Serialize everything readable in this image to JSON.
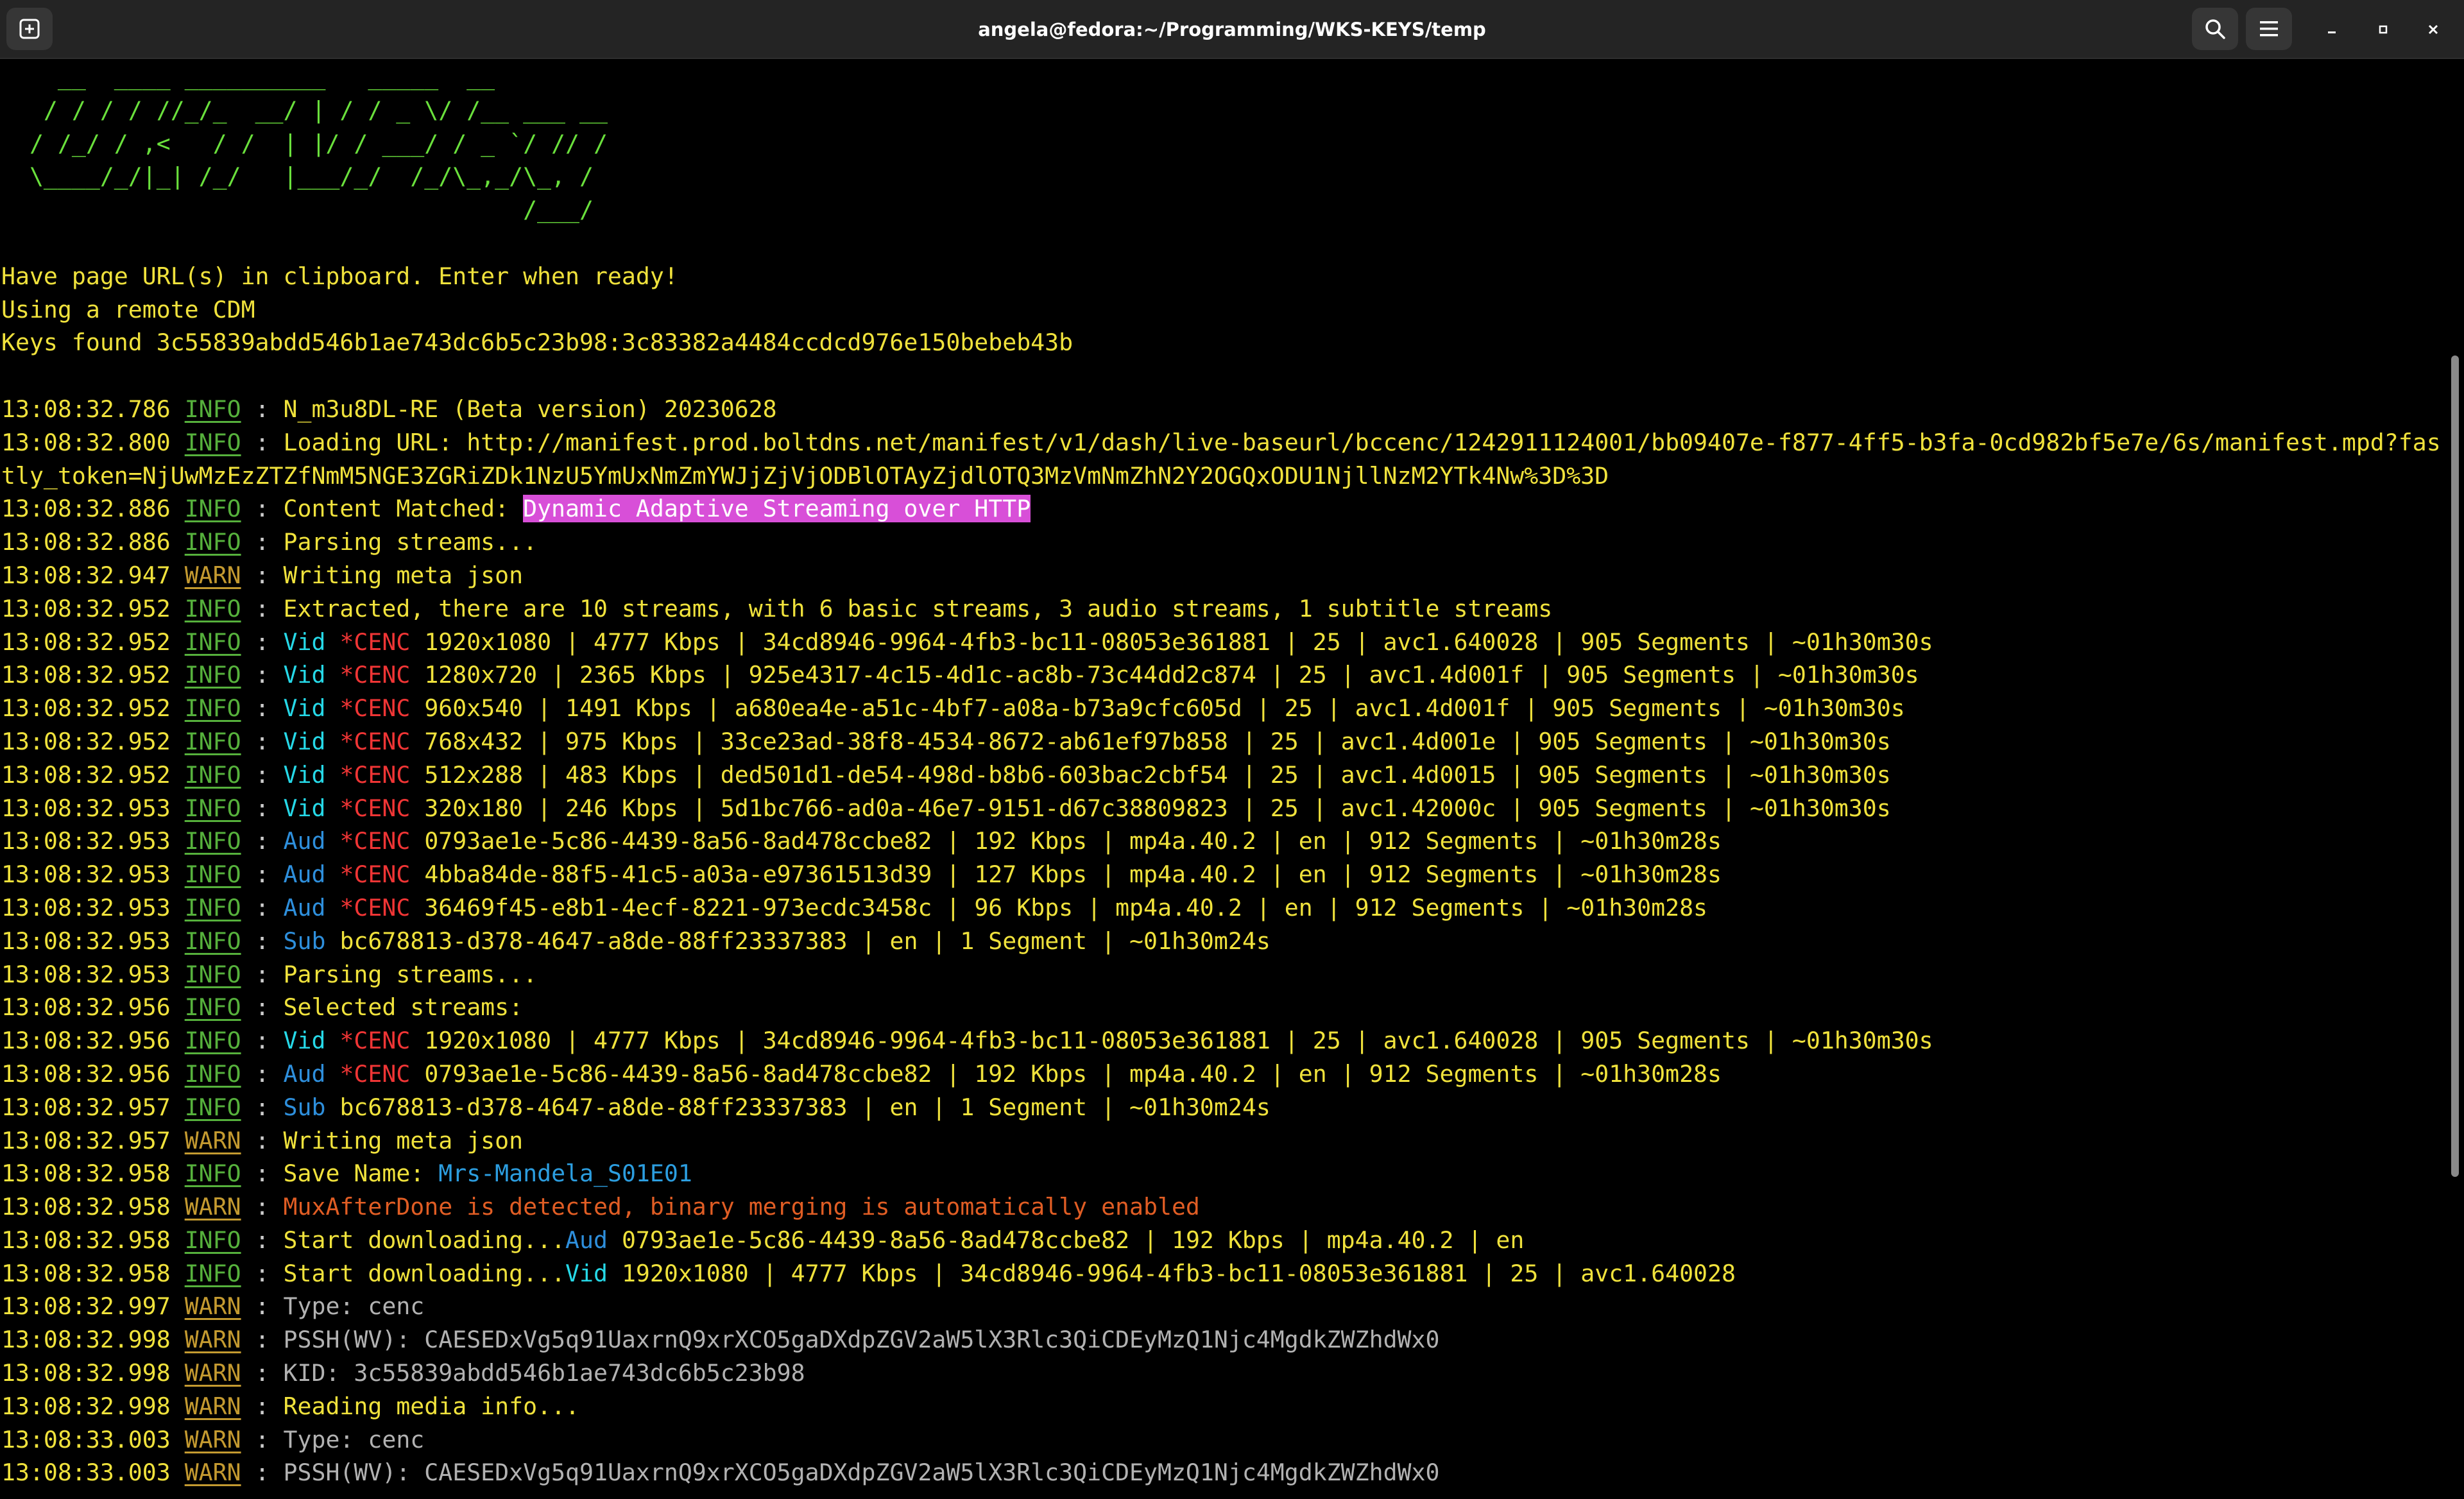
{
  "window": {
    "title": "angela@fedora:~/Programming/WKS-KEYS/temp",
    "icons": {
      "new_tab": "new-tab-icon",
      "search": "search-icon",
      "menu": "hamburger-menu-icon",
      "minimize": "minimize-icon",
      "maximize": "maximize-icon",
      "close": "close-icon"
    }
  },
  "terminal": {
    "banner": [
      "    __  ____ __________   _____  __",
      "   / / / / //_/_  __/ | / / _ \\/ /__ ___ __",
      "  / /_/ / ,<   / /  | |/ / ___/ / _ `/ // /",
      "  \\____/_/|_| /_/   |___/_/  /_/\\_,_/\\_, /",
      "                                     /___/"
    ],
    "messages": [
      "Have page URL(s) in clipboard. Enter when ready!",
      "Using a remote CDM",
      "Keys found 3c55839abdd546b1ae743dc6b5c23b98:3c83382a4484ccdcd976e150bebeb43b"
    ],
    "log": [
      {
        "time": "13:08:32.786",
        "level": "INFO",
        "text": "N_m3u8DL-RE (Beta version) 20230628"
      },
      {
        "time": "13:08:32.800",
        "level": "INFO",
        "text": "Loading URL: http://manifest.prod.boltdns.net/manifest/v1/dash/live-baseurl/bccenc/1242911124001/bb09407e-f877-4ff5-b3fa-0cd982bf5e7e/6s/manifest.mpd?fas",
        "cont": "tly_token=NjUwMzEzZTZfNmM5NGE3ZGRiZDk1NzU5YmUxNmZmYWJjZjVjODBlOTAyZjdlOTQ3MzVmNmZhN2Y2OGQxODU1NjllNzM2YTk4Nw%3D%3D"
      },
      {
        "time": "13:08:32.886",
        "level": "INFO",
        "pre": "Content Matched: ",
        "highlight": "Dynamic Adaptive Streaming over HTTP"
      },
      {
        "time": "13:08:32.886",
        "level": "INFO",
        "text": "Parsing streams..."
      },
      {
        "time": "13:08:32.947",
        "level": "WARN",
        "text": "Writing meta json"
      },
      {
        "time": "13:08:32.952",
        "level": "INFO",
        "text": "Extracted, there are 10 streams, with 6 basic streams, 3 audio streams, 1 subtitle streams"
      },
      {
        "time": "13:08:32.952",
        "level": "INFO",
        "kind": "Vid",
        "cenc": "*CENC",
        "text": "1920x1080 | 4777 Kbps | 34cd8946-9964-4fb3-bc11-08053e361881 | 25 | avc1.640028 | 905 Segments | ~01h30m30s"
      },
      {
        "time": "13:08:32.952",
        "level": "INFO",
        "kind": "Vid",
        "cenc": "*CENC",
        "text": "1280x720 | 2365 Kbps | 925e4317-4c15-4d1c-ac8b-73c44dd2c874 | 25 | avc1.4d001f | 905 Segments | ~01h30m30s"
      },
      {
        "time": "13:08:32.952",
        "level": "INFO",
        "kind": "Vid",
        "cenc": "*CENC",
        "text": "960x540 | 1491 Kbps | a680ea4e-a51c-4bf7-a08a-b73a9cfc605d | 25 | avc1.4d001f | 905 Segments | ~01h30m30s"
      },
      {
        "time": "13:08:32.952",
        "level": "INFO",
        "kind": "Vid",
        "cenc": "*CENC",
        "text": "768x432 | 975 Kbps | 33ce23ad-38f8-4534-8672-ab61ef97b858 | 25 | avc1.4d001e | 905 Segments | ~01h30m30s"
      },
      {
        "time": "13:08:32.952",
        "level": "INFO",
        "kind": "Vid",
        "cenc": "*CENC",
        "text": "512x288 | 483 Kbps | ded501d1-de54-498d-b8b6-603bac2cbf54 | 25 | avc1.4d0015 | 905 Segments | ~01h30m30s"
      },
      {
        "time": "13:08:32.953",
        "level": "INFO",
        "kind": "Vid",
        "cenc": "*CENC",
        "text": "320x180 | 246 Kbps | 5d1bc766-ad0a-46e7-9151-d67c38809823 | 25 | avc1.42000c | 905 Segments | ~01h30m30s"
      },
      {
        "time": "13:08:32.953",
        "level": "INFO",
        "kind": "Aud",
        "cenc": "*CENC",
        "text": "0793ae1e-5c86-4439-8a56-8ad478ccbe82 | 192 Kbps | mp4a.40.2 | en | 912 Segments | ~01h30m28s"
      },
      {
        "time": "13:08:32.953",
        "level": "INFO",
        "kind": "Aud",
        "cenc": "*CENC",
        "text": "4bba84de-88f5-41c5-a03a-e97361513d39 | 127 Kbps | mp4a.40.2 | en | 912 Segments | ~01h30m28s"
      },
      {
        "time": "13:08:32.953",
        "level": "INFO",
        "kind": "Aud",
        "cenc": "*CENC",
        "text": "36469f45-e8b1-4ecf-8221-973ecdc3458c | 96 Kbps | mp4a.40.2 | en | 912 Segments | ~01h30m28s"
      },
      {
        "time": "13:08:32.953",
        "level": "INFO",
        "kind": "Sub",
        "text": "bc678813-d378-4647-a8de-88ff23337383 | en | 1 Segment | ~01h30m24s"
      },
      {
        "time": "13:08:32.953",
        "level": "INFO",
        "text": "Parsing streams..."
      },
      {
        "time": "13:08:32.956",
        "level": "INFO",
        "text": "Selected streams:"
      },
      {
        "time": "13:08:32.956",
        "level": "INFO",
        "kind": "Vid",
        "cenc": "*CENC",
        "text": "1920x1080 | 4777 Kbps | 34cd8946-9964-4fb3-bc11-08053e361881 | 25 | avc1.640028 | 905 Segments | ~01h30m30s"
      },
      {
        "time": "13:08:32.956",
        "level": "INFO",
        "kind": "Aud",
        "cenc": "*CENC",
        "text": "0793ae1e-5c86-4439-8a56-8ad478ccbe82 | 192 Kbps | mp4a.40.2 | en | 912 Segments | ~01h30m28s"
      },
      {
        "time": "13:08:32.957",
        "level": "INFO",
        "kind": "Sub",
        "text": "bc678813-d378-4647-a8de-88ff23337383 | en | 1 Segment | ~01h30m24s"
      },
      {
        "time": "13:08:32.957",
        "level": "WARN",
        "text": "Writing meta json"
      },
      {
        "time": "13:08:32.958",
        "level": "INFO",
        "pre": "Save Name: ",
        "name": "Mrs-Mandela_S01E01"
      },
      {
        "time": "13:08:32.958",
        "level": "WARN",
        "alert": "MuxAfterDone is detected, binary merging is automatically enabled"
      },
      {
        "time": "13:08:32.958",
        "level": "INFO",
        "pre": "Start downloading...",
        "kind": "Aud",
        "text": "0793ae1e-5c86-4439-8a56-8ad478ccbe82 | 192 Kbps | mp4a.40.2 | en"
      },
      {
        "time": "13:08:32.958",
        "level": "INFO",
        "pre": "Start downloading...",
        "kind": "Vid",
        "text": "1920x1080 | 4777 Kbps | 34cd8946-9964-4fb3-bc11-08053e361881 | 25 | avc1.640028"
      },
      {
        "time": "13:08:32.997",
        "level": "WARN",
        "dim": "Type: cenc"
      },
      {
        "time": "13:08:32.998",
        "level": "WARN",
        "dim": "PSSH(WV): CAESEDxVg5q91UaxrnQ9xrXCO5gaDXdpZGV2aW5lX3Rlc3QiCDEyMzQ1Njc4MgdkZWZhdWx0"
      },
      {
        "time": "13:08:32.998",
        "level": "WARN",
        "dim": "KID: 3c55839abdd546b1ae743dc6b5c23b98"
      },
      {
        "time": "13:08:32.998",
        "level": "WARN",
        "text": "Reading media info..."
      },
      {
        "time": "13:08:33.003",
        "level": "WARN",
        "dim": "Type: cenc"
      },
      {
        "time": "13:08:33.003",
        "level": "WARN",
        "dim": "PSSH(WV): CAESEDxVg5q91UaxrnQ9xrXCO5gaDXdpZGV2aW5lX3Rlc3QiCDEyMzQ1Njc4MgdkZWZhdWx0"
      }
    ]
  },
  "colors": {
    "background": "#000000",
    "titlebar": "#242424",
    "banner_green": "#6ae03c",
    "text_yellow": "#f0e23c",
    "info_green": "#56b13c",
    "warn_amber": "#c49a30",
    "vid_cyan": "#26d9e8",
    "aud_blue": "#2e8fdc",
    "cenc_red": "#f03535",
    "highlight_magenta": "#d84fd8",
    "alert_orange": "#e05d24"
  }
}
